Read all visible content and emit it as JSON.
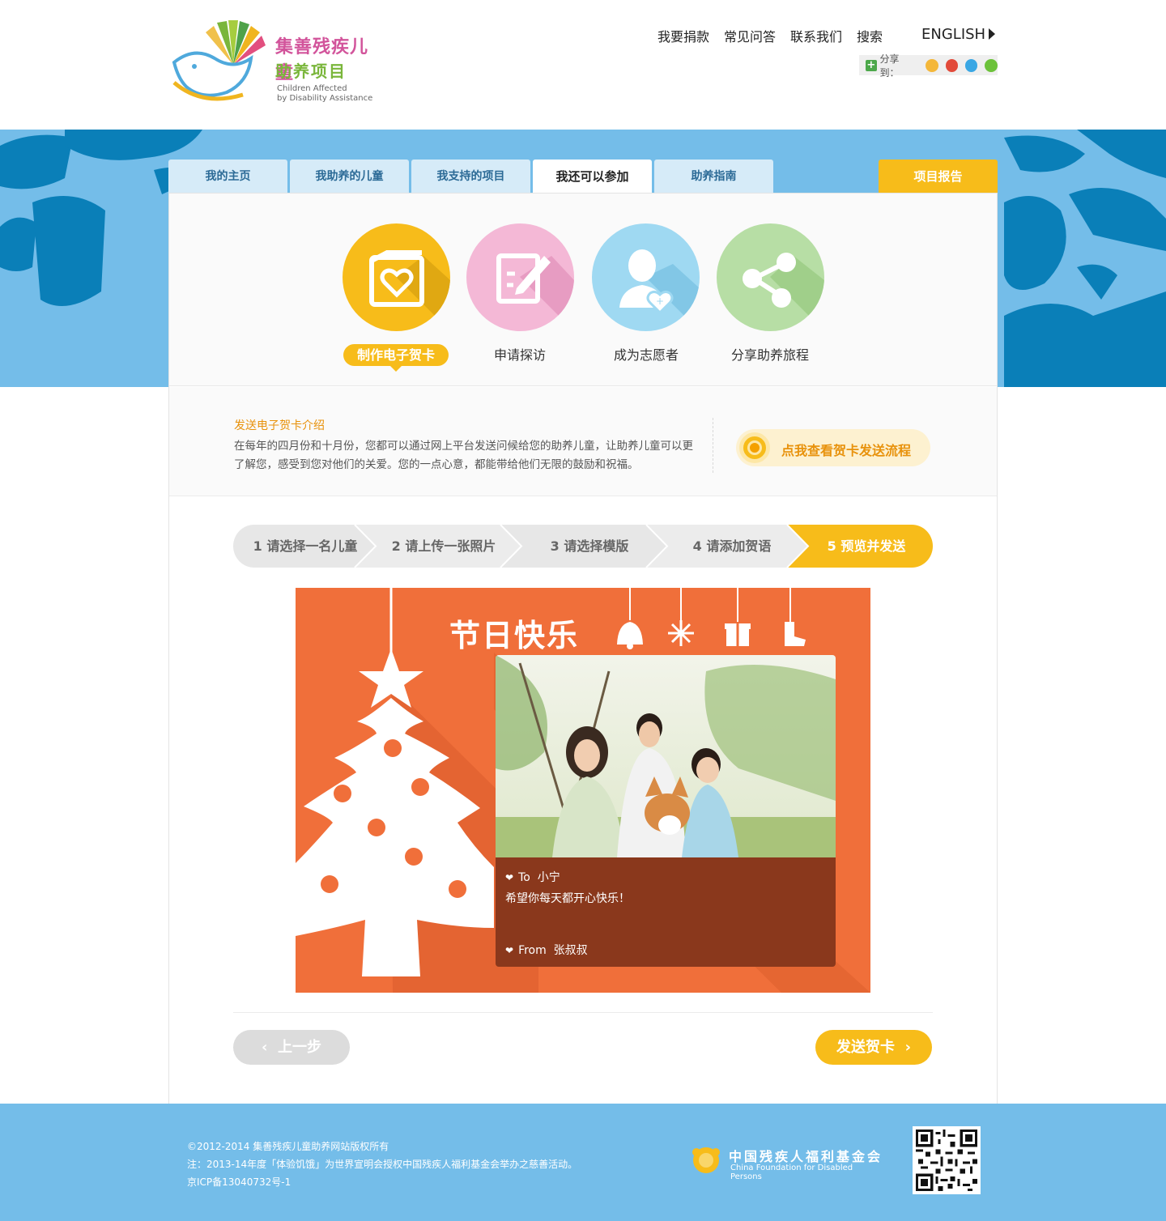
{
  "header": {
    "logo": {
      "cn_line1": "集善残疾儿童",
      "cn_line2": "助养项目",
      "en_line1": "Children Affected",
      "en_line2": "by Disability Assistance"
    },
    "nav": [
      "我要捐款",
      "常见问答",
      "联系我们",
      "搜索"
    ],
    "language_link": "ENGLISH",
    "share_label": "分享到："
  },
  "tabs": [
    {
      "label": "我的主页"
    },
    {
      "label": "我助养的儿童"
    },
    {
      "label": "我支持的项目"
    },
    {
      "label": "我还可以参加"
    },
    {
      "label": "助养指南"
    }
  ],
  "report_tab": "项目报告",
  "actions": [
    {
      "label": "制作电子贺卡",
      "icon": "card-heart-icon",
      "color": "#f7bc1a"
    },
    {
      "label": "申请探访",
      "icon": "edit-form-icon",
      "color": "#f4b8d6"
    },
    {
      "label": "成为志愿者",
      "icon": "volunteer-icon",
      "color": "#9fd9f2"
    },
    {
      "label": "分享助养旅程",
      "icon": "share-icon",
      "color": "#b7dea5"
    }
  ],
  "intro": {
    "title": "发送电子贺卡介绍",
    "text": "在每年的四月份和十月份，您都可以通过网上平台发送问候给您的助养儿童，让助养儿童可以更了解您，感受到您对他们的关爱。您的一点心意，都能带给他们无限的鼓励和祝福。",
    "flow_button": "点我查看贺卡发送流程"
  },
  "steps": [
    {
      "num": "1",
      "label": "请选择一名儿童"
    },
    {
      "num": "2",
      "label": "请上传一张照片"
    },
    {
      "num": "3",
      "label": "请选择模版"
    },
    {
      "num": "4",
      "label": "请添加贺语"
    },
    {
      "num": "5",
      "label": "预览并发送"
    }
  ],
  "card": {
    "title": "节日快乐",
    "to_prefix": "To",
    "to_name": "小宁",
    "message": "希望你每天都开心快乐！",
    "from_prefix": "From",
    "from_name": "张叔叔"
  },
  "buttons": {
    "prev": "上一步",
    "send": "发送贺卡"
  },
  "footer": {
    "copyright": "©2012-2014 集善残疾儿童助养网站版权所有",
    "note": "注：2013-14年度「体验饥饿」为世界宣明会授权中国残疾人福利基金会举办之慈善活动。",
    "icp": "京ICP备13040732号-1",
    "foundation_cn": "中国残疾人福利基金会",
    "foundation_en": "China Foundation for Disabled Persons"
  },
  "colors": {
    "accent": "#f7bc1a",
    "sky": "#74bde9",
    "card_orange": "#f06f3a",
    "card_brown": "#8a381c"
  }
}
